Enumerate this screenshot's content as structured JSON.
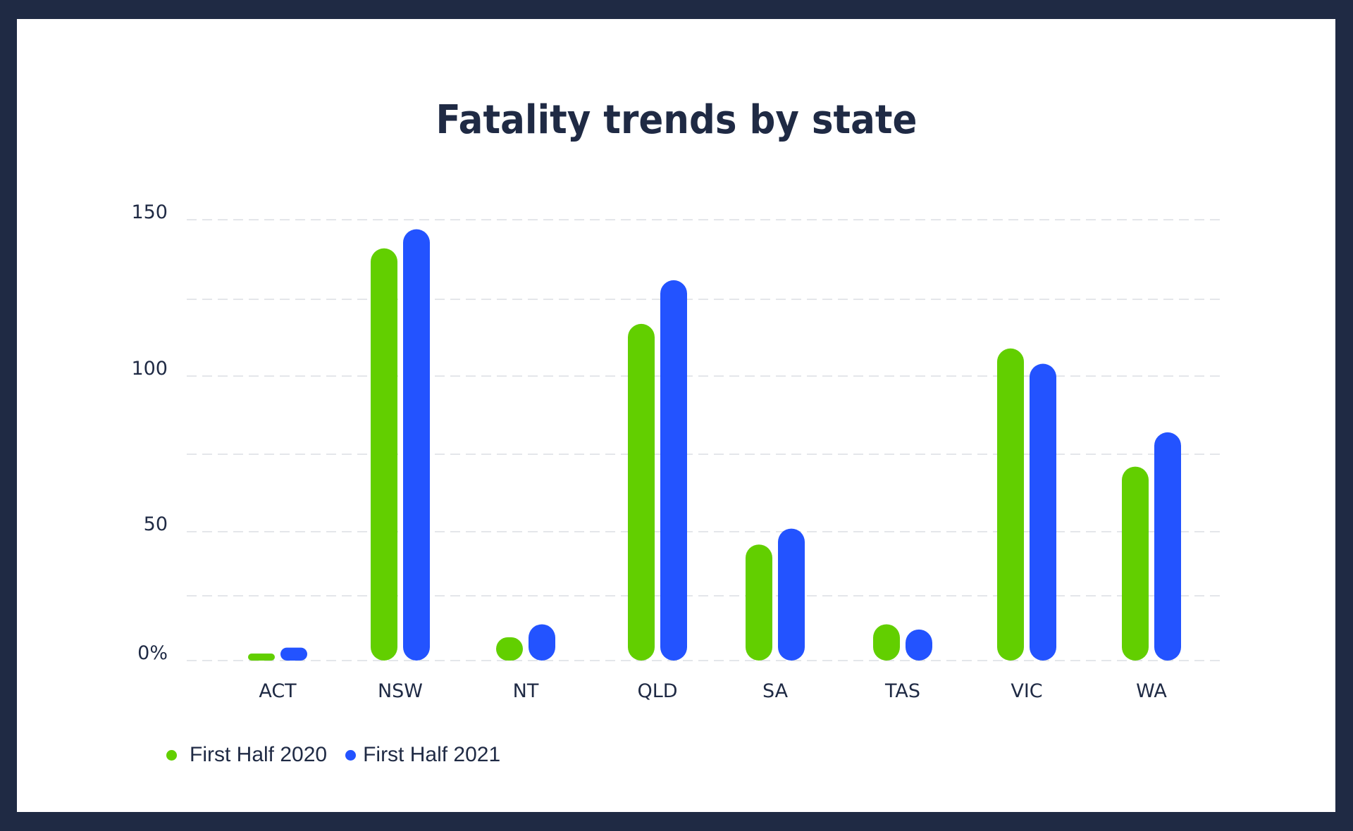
{
  "chart_data": {
    "type": "bar",
    "title": "Fatality trends by state",
    "xlabel": "",
    "ylabel": "",
    "categories": [
      "ACT",
      "NSW",
      "NT",
      "QLD",
      "SA",
      "TAS",
      "VIC",
      "WA"
    ],
    "series": [
      {
        "name": "First Half 2020",
        "color": "#62cf00",
        "values": [
          2,
          141,
          9,
          117,
          45,
          14,
          109,
          71
        ]
      },
      {
        "name": "First Half 2021",
        "color": "#2353ff",
        "values": [
          5,
          147,
          14,
          131,
          51,
          12,
          104,
          82
        ]
      }
    ],
    "yticks": [
      {
        "value": 0,
        "label": "0%"
      },
      {
        "value": 50,
        "label": "50"
      },
      {
        "value": 100,
        "label": "100"
      },
      {
        "value": 150,
        "label": "150"
      }
    ],
    "minor_gridlines": [
      25,
      75,
      125
    ],
    "ylim": [
      0,
      150
    ],
    "grid": true,
    "legend_position": "bottom-left"
  }
}
